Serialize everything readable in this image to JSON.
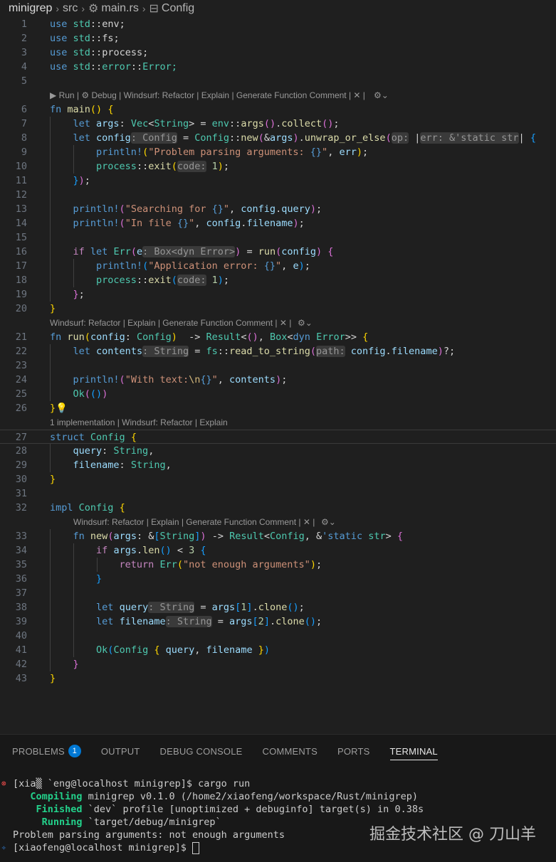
{
  "breadcrumb": {
    "root": "minigrep",
    "folder": "src",
    "file": "main.rs",
    "symbol": "Config"
  },
  "lens": {
    "main": "▶ Run | ⚙ Debug | Windsurf: Refactor | Explain | Generate Function Comment | ✕ |",
    "run": "Windsurf: Refactor | Explain | Generate Function Comment | ✕ |",
    "struct": "1 implementation | Windsurf: Refactor | Explain",
    "new": "Windsurf: Refactor | Explain | Generate Function Comment | ✕ |"
  },
  "line_numbers": [
    "1",
    "2",
    "3",
    "4",
    "5",
    "6",
    "7",
    "8",
    "9",
    "10",
    "11",
    "12",
    "13",
    "14",
    "15",
    "16",
    "17",
    "18",
    "19",
    "20",
    "21",
    "22",
    "23",
    "24",
    "25",
    "26",
    "27",
    "28",
    "29",
    "30",
    "31",
    "32",
    "33",
    "34",
    "35",
    "36",
    "37",
    "38",
    "39",
    "40",
    "41",
    "42",
    "43"
  ],
  "code": {
    "use1": "env;",
    "use2": "fs;",
    "use3": "process;",
    "use4": "Error;",
    "msg_parse": "\"Problem parsing arguments: ",
    "msg_search": "\"Searching for ",
    "msg_file": "\"In file ",
    "msg_app": "\"Application error: ",
    "msg_with": "\"With text:",
    "msg_notenough": "\"not enough arguments\""
  },
  "panel": {
    "tabs": [
      "PROBLEMS",
      "OUTPUT",
      "DEBUG CONSOLE",
      "COMMENTS",
      "PORTS",
      "TERMINAL"
    ],
    "problems_count": "1",
    "terminal": {
      "line1": "[xia▒ `eng@localhost minigrep]$ cargo run",
      "compiling_label": "Compiling",
      "compiling_text": " minigrep v0.1.0 (/home2/xiaofeng/workspace/Rust/minigrep)",
      "finished_label": "Finished",
      "finished_text": " `dev` profile [unoptimized + debuginfo] target(s) in 0.38s",
      "running_label": "Running",
      "running_text": " `target/debug/minigrep`",
      "output": "Problem parsing arguments: not enough arguments",
      "prompt": "[xiaofeng@localhost minigrep]$ "
    }
  },
  "watermark": "掘金技术社区 @ 刀山羊",
  "colors": {
    "keyword": "#569cd6",
    "type": "#4ec9b0",
    "function": "#dcdcaa",
    "string": "#ce9178",
    "variable": "#9cdcfe",
    "terminal_green": "#23d18b",
    "badge": "#0078d4"
  }
}
